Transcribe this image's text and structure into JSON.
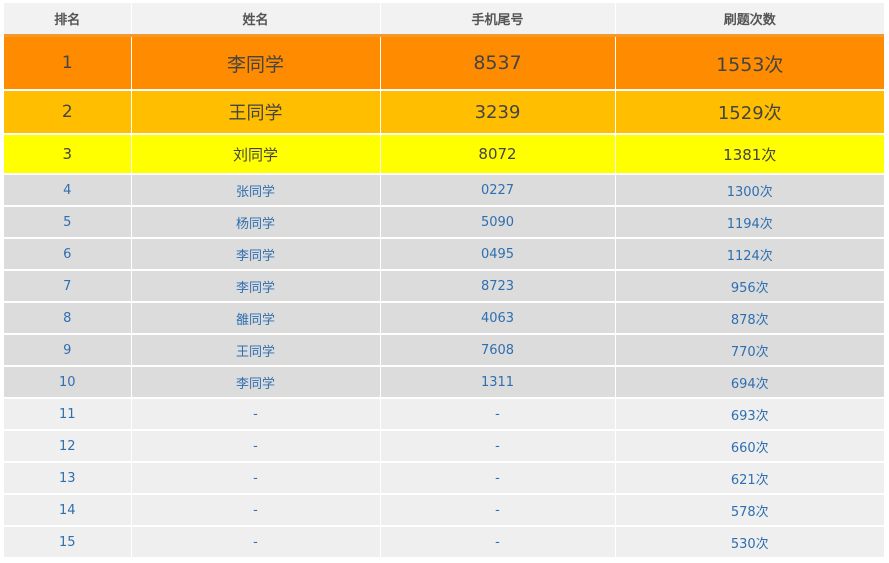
{
  "header": {
    "rank": "排名",
    "name": "姓名",
    "phone": "手机尾号",
    "count": "刷题次数"
  },
  "rows": [
    {
      "rank": "1",
      "name": "李同学",
      "phone": "8537",
      "count": "1553次"
    },
    {
      "rank": "2",
      "name": "王同学",
      "phone": "3239",
      "count": "1529次"
    },
    {
      "rank": "3",
      "name": "刘同学",
      "phone": "8072",
      "count": "1381次"
    },
    {
      "rank": "4",
      "name": "张同学",
      "phone": "0227",
      "count": "1300次"
    },
    {
      "rank": "5",
      "name": "杨同学",
      "phone": "5090",
      "count": "1194次"
    },
    {
      "rank": "6",
      "name": "李同学",
      "phone": "0495",
      "count": "1124次"
    },
    {
      "rank": "7",
      "name": "李同学",
      "phone": "8723",
      "count": "956次"
    },
    {
      "rank": "8",
      "name": "雒同学",
      "phone": "4063",
      "count": "878次"
    },
    {
      "rank": "9",
      "name": "王同学",
      "phone": "7608",
      "count": "770次"
    },
    {
      "rank": "10",
      "name": "李同学",
      "phone": "1311",
      "count": "694次"
    },
    {
      "rank": "11",
      "name": "-",
      "phone": "-",
      "count": "693次"
    },
    {
      "rank": "12",
      "name": "-",
      "phone": "-",
      "count": "660次"
    },
    {
      "rank": "13",
      "name": "-",
      "phone": "-",
      "count": "621次"
    },
    {
      "rank": "14",
      "name": "-",
      "phone": "-",
      "count": "578次"
    },
    {
      "rank": "15",
      "name": "-",
      "phone": "-",
      "count": "530次"
    }
  ],
  "colors": {
    "header_bg": "#f2f2f2",
    "header_underline": "#f29a2e",
    "rank1_bg": "#ff8c00",
    "rank2_bg": "#ffbf00",
    "rank3_bg": "#ffff00",
    "ranks4to10_bg": "#dcdcdc",
    "ranks11to15_bg": "#efefef",
    "link_text": "#2f6fb0"
  }
}
